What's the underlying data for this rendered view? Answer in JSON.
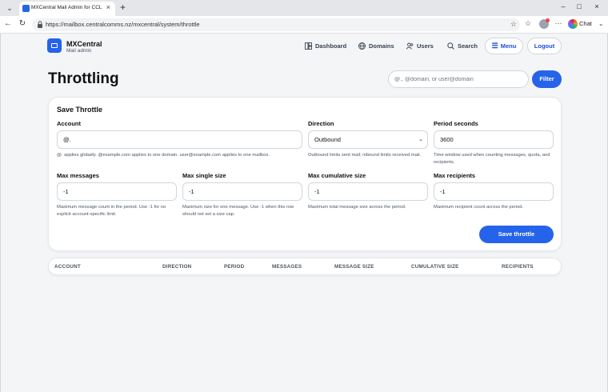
{
  "browser": {
    "tab_title": "MXCentral Mail Admin for CCL",
    "url": "https://mailbox.centralcomms.nz/mxcentral/system/throttle",
    "chat_label": "Chat"
  },
  "header": {
    "brand": "MXCentral",
    "brand_sub": "Mail admin",
    "nav": {
      "dashboard": "Dashboard",
      "domains": "Domains",
      "users": "Users",
      "search": "Search"
    },
    "menu_label": "Menu",
    "logout_label": "Logout"
  },
  "page": {
    "title": "Throttling",
    "search_placeholder": "@., @domain, or user@domain",
    "filter_label": "Filter"
  },
  "form": {
    "title": "Save Throttle",
    "account": {
      "label": "Account",
      "value": "@.",
      "help": "@. applies globally. @example.com applies to one domain. user@example.com applies to one mailbox."
    },
    "direction": {
      "label": "Direction",
      "value": "Outbound",
      "help": "Outbound limits sent mail; inbound limits received mail."
    },
    "period": {
      "label": "Period seconds",
      "value": "3600",
      "help": "Time window used when counting messages, quota, and recipients."
    },
    "max_messages": {
      "label": "Max messages",
      "value": "-1",
      "help": "Maximum message count in the period. Use -1 for no explicit account-specific limit."
    },
    "max_single_size": {
      "label": "Max single size",
      "value": "-1",
      "help": "Maximum size for one message. Use -1 when this row should not set a size cap."
    },
    "max_cumulative_size": {
      "label": "Max cumulative size",
      "value": "-1",
      "help": "Maximum total message size across the period."
    },
    "max_recipients": {
      "label": "Max recipients",
      "value": "-1",
      "help": "Maximum recipient count across the period."
    },
    "save_label": "Save throttle"
  },
  "table": {
    "columns": [
      "ACCOUNT",
      "DIRECTION",
      "PERIOD",
      "MESSAGES",
      "MESSAGE SIZE",
      "CUMULATIVE SIZE",
      "RECIPIENTS"
    ]
  },
  "colors": {
    "accent": "#2563eb",
    "background": "#f4f5f7"
  },
  "icons": [
    "dashboard-icon",
    "globe-icon",
    "users-icon",
    "search-icon",
    "hamburger-icon",
    "mail-logo-icon"
  ]
}
